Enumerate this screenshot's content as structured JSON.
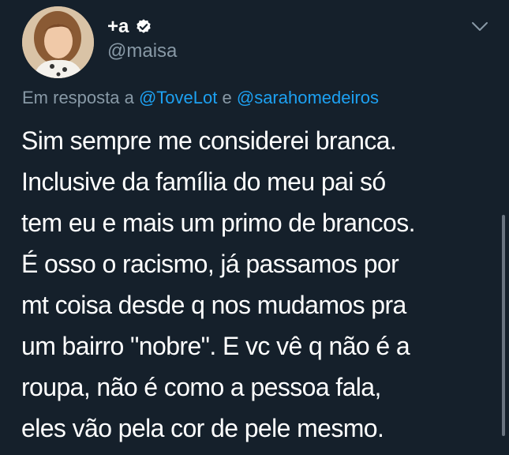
{
  "author": {
    "display_name": "+a",
    "handle": "@maisa",
    "verified": true
  },
  "reply": {
    "prefix": "Em resposta a",
    "mention1": "@ToveLot",
    "conjunction": "e",
    "mention2": "@sarahomedeiros"
  },
  "tweet": {
    "lines": [
      "Sim sempre me considerei branca.",
      "Inclusive da família do meu pai só",
      "tem eu e mais um primo de brancos.",
      "É osso o racismo, já passamos por",
      "mt coisa desde q nos mudamos pra",
      "um bairro \"nobre\". E vc vê q não é a",
      "roupa, não é como a pessoa fala,",
      "eles vão pela cor de pele mesmo."
    ]
  },
  "colors": {
    "background": "#15202b",
    "text": "#ffffff",
    "secondary": "#8899a6",
    "accent": "#1da1f2"
  },
  "icons": {
    "verified": "verified-badge-icon",
    "menu": "chevron-down-icon"
  }
}
